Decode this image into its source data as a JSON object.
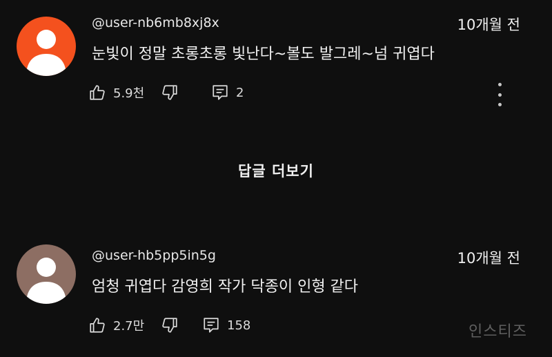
{
  "comments": [
    {
      "handle": "@user-nb6mb8xj8x",
      "time": "10개월 전",
      "text": "눈빛이 정말 초롱초롱 빛난다~볼도 발그레~넘 귀엽다",
      "likes": "5.9천",
      "replies": "2",
      "avatar_color": "#f4511e"
    },
    {
      "handle": "@user-hb5pp5in5g",
      "time": "10개월 전",
      "text": "엄청 귀엽다 감영희 작가 닥종이 인형 같다",
      "likes": "2.7만",
      "replies": "158",
      "avatar_color": "#8d6e63"
    }
  ],
  "more_replies_label": "답글 더보기",
  "watermark": "인스티즈",
  "icons": {
    "like": "thumbs-up-icon",
    "dislike": "thumbs-down-icon",
    "reply": "reply-comment-icon",
    "more": "more-vertical-icon"
  },
  "colors": {
    "background": "#0f0f0f",
    "text": "#f1f1f1"
  }
}
